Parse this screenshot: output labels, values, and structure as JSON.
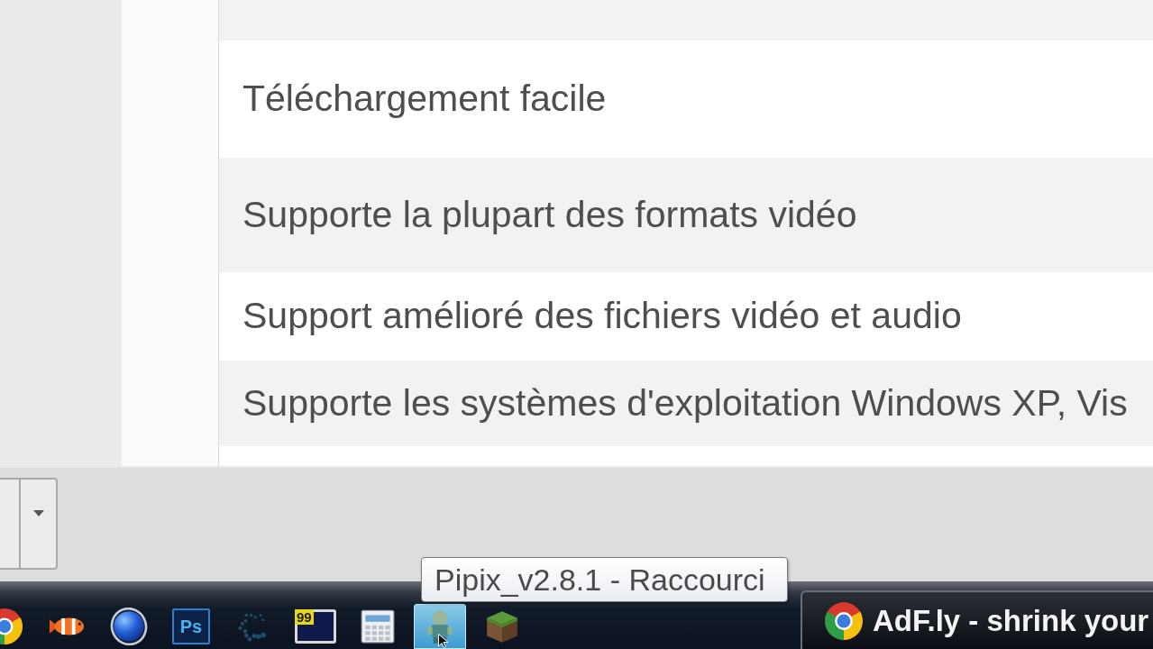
{
  "feature_list": {
    "rows": [
      {
        "text": "Téléchargement facile"
      },
      {
        "text": "Supporte la plupart des formats vidéo"
      },
      {
        "text": "Support amélioré des fichiers vidéo et audio"
      },
      {
        "text": "Supporte les systèmes d'exploitation Windows XP, Vis"
      }
    ]
  },
  "taskbar": {
    "pinned": [
      {
        "kind": "browser",
        "hovered": false
      },
      {
        "kind": "fish",
        "hovered": false
      },
      {
        "kind": "globe",
        "hovered": false
      },
      {
        "kind": "ps",
        "label": "Ps",
        "hovered": false
      },
      {
        "kind": "spinner",
        "hovered": false
      },
      {
        "kind": "monitor",
        "label": "99",
        "hovered": false
      },
      {
        "kind": "calculator",
        "hovered": false
      },
      {
        "kind": "figure",
        "hovered": true
      },
      {
        "kind": "cube",
        "hovered": false
      }
    ],
    "tooltip": "Pipix_v2.8.1 - Raccourci",
    "windows": [
      {
        "kind": "browser",
        "title": "AdF.ly - shrink your"
      }
    ]
  }
}
